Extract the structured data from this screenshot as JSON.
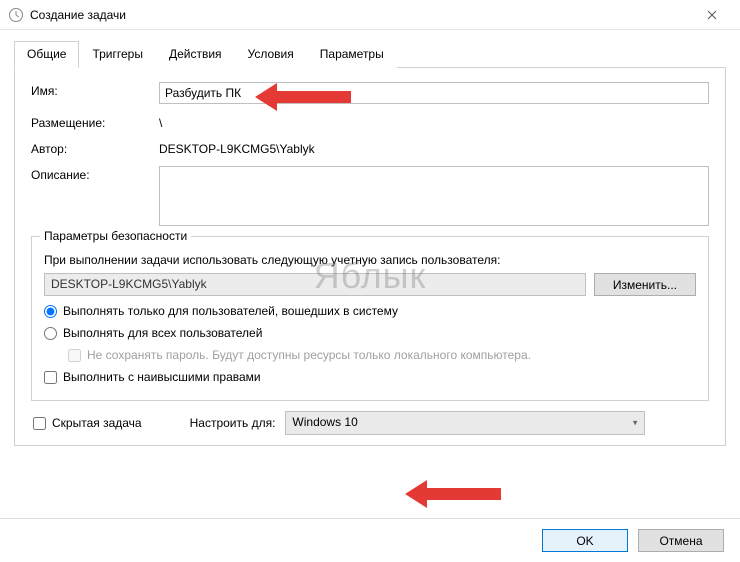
{
  "window": {
    "title": "Создание задачи"
  },
  "tabs": {
    "t0": "Общие",
    "t1": "Триггеры",
    "t2": "Действия",
    "t3": "Условия",
    "t4": "Параметры"
  },
  "fields": {
    "name_label": "Имя:",
    "name_value": "Разбудить ПК",
    "location_label": "Размещение:",
    "location_value": "\\",
    "author_label": "Автор:",
    "author_value": "DESKTOP-L9KCMG5\\Yablyk",
    "description_label": "Описание:"
  },
  "security": {
    "group_title": "Параметры безопасности",
    "desc": "При выполнении задачи использовать следующую учетную запись пользователя:",
    "account": "DESKTOP-L9KCMG5\\Yablyk",
    "change_btn": "Изменить...",
    "radio_logged": "Выполнять только для пользователей, вошедших в систему",
    "radio_all": "Выполнять для всех пользователей",
    "no_store_pw": "Не сохранять пароль. Будут доступны ресурсы только локального компьютера.",
    "highest_priv": "Выполнить с наивысшими правами"
  },
  "bottom": {
    "hidden_task": "Скрытая задача",
    "configure_for_label": "Настроить для:",
    "configure_for_value": "Windows 10"
  },
  "footer": {
    "ok": "OK",
    "cancel": "Отмена"
  },
  "watermark": "Яблык"
}
